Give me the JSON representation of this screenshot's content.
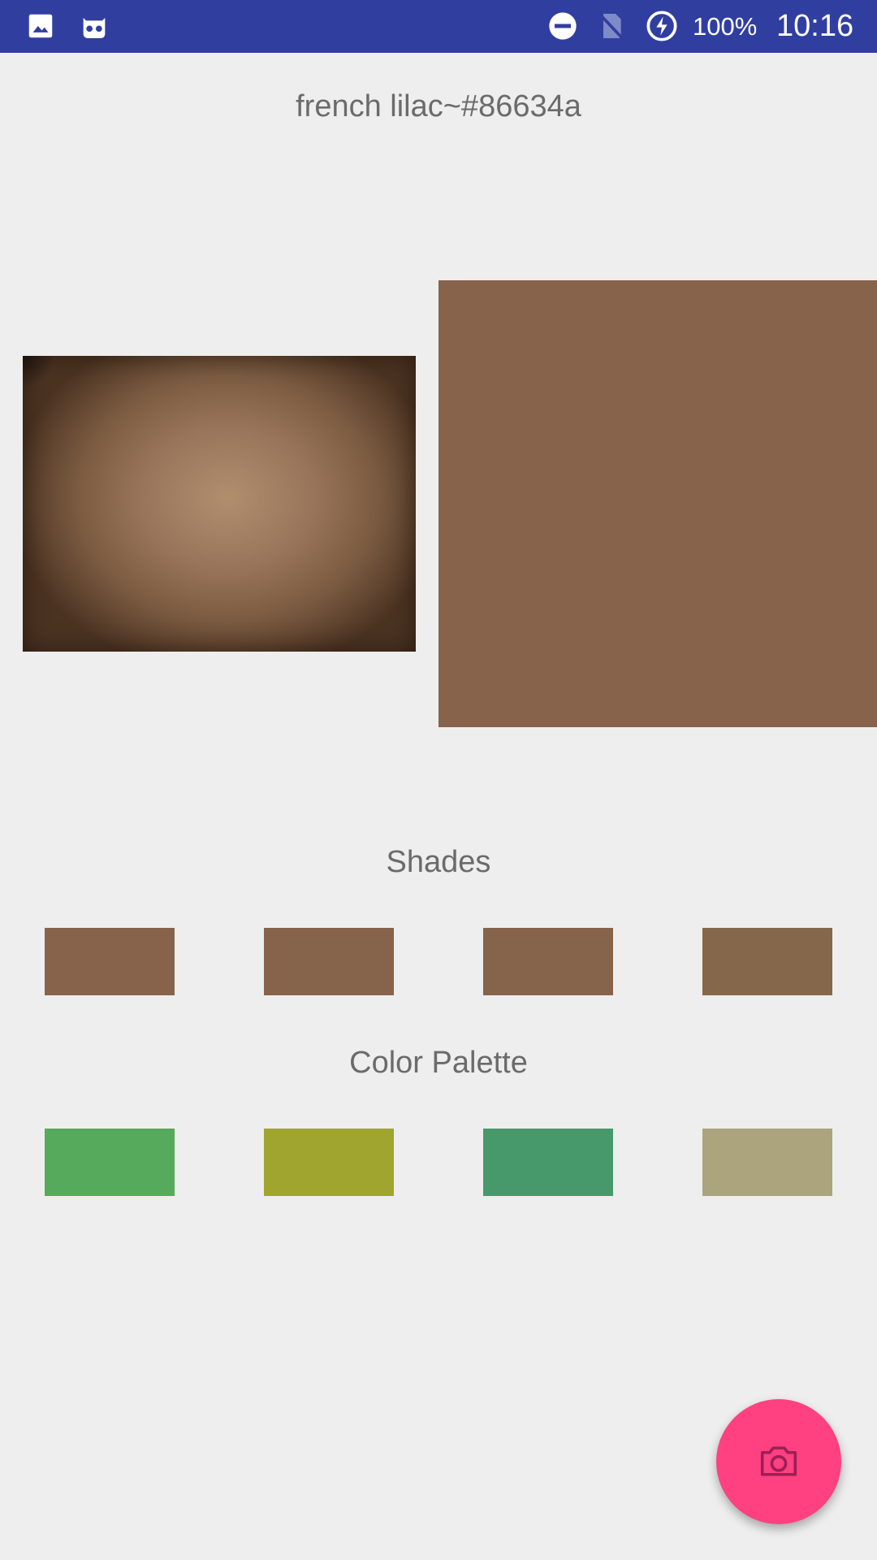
{
  "status_bar": {
    "background": "#303f9f",
    "left_icons": [
      "image-icon",
      "cyanogen-mod-icon"
    ],
    "right_icons": [
      "do-not-disturb-icon",
      "no-sim-icon",
      "battery-charging-icon"
    ],
    "battery": "100%",
    "time": "10:16"
  },
  "header": {
    "color_name": "french lilac~#86634a"
  },
  "preview": {
    "selected_color": "#86634a"
  },
  "shades": {
    "label": "Shades",
    "colors": [
      "#86634a",
      "#86634b",
      "#86634b",
      "#85674b"
    ]
  },
  "palette": {
    "label": "Color Palette",
    "colors": [
      "#55ab5b",
      "#9fa52e",
      "#47996b",
      "#aba47d"
    ]
  },
  "fab": {
    "icon": "camera-icon",
    "color": "#ff4081"
  }
}
